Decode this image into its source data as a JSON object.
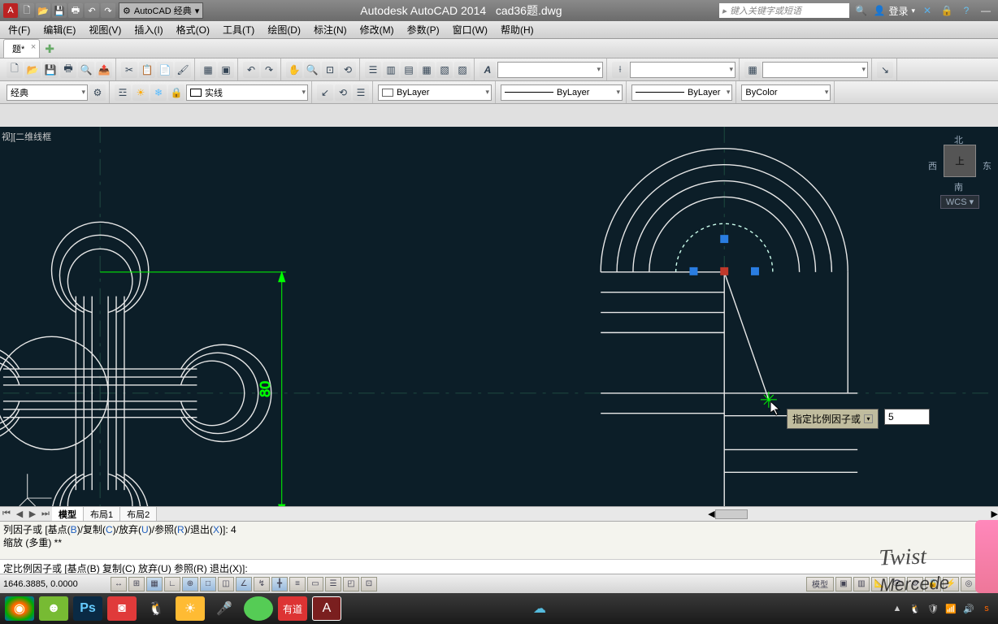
{
  "title": {
    "app": "Autodesk AutoCAD 2014",
    "file": "cad36题.dwg"
  },
  "workspace_dd": "AutoCAD 经典",
  "search_placeholder": "键入关键字或短语",
  "login_label": "登录",
  "menu": [
    "件(F)",
    "编辑(E)",
    "视图(V)",
    "插入(I)",
    "格式(O)",
    "工具(T)",
    "绘图(D)",
    "标注(N)",
    "修改(M)",
    "参数(P)",
    "窗口(W)",
    "帮助(H)"
  ],
  "doc_tab": "题*",
  "toolbar2": {
    "ws_dd": "经典",
    "linetype_dd": "实线",
    "layer_color": "ByLayer",
    "lineweight": "ByLayer",
    "linetype2": "ByLayer",
    "plotstyle": "ByColor"
  },
  "view_label": "视][二维线框",
  "viewcube": {
    "n": "北",
    "s": "南",
    "w": "西",
    "e": "东",
    "top": "上",
    "wcs": "WCS"
  },
  "dimension_value": "80",
  "dyn_prompt": "指定比例因子或",
  "dyn_input_value": "5",
  "layout_tabs": [
    "模型",
    "布局1",
    "布局2"
  ],
  "cmd_history": {
    "line1_pre": "列因子或 [基点(",
    "line1_b": "B",
    "line1_mid1": ")/复制(",
    "line1_c": "C",
    "line1_mid2": ")/放弃(",
    "line1_u": "U",
    "line1_mid3": ")/参照(",
    "line1_r": "R",
    "line1_mid4": ")/退出(",
    "line1_x": "X",
    "line1_post": ")]:  4",
    "line2": "缩放 (多重) **"
  },
  "cmd_prompt": {
    "pre": "定比例因子或 [基点(",
    "b": "B",
    "m1": ") 复制(",
    "c": "C",
    "m2": ") 放弃(",
    "u": "U",
    "m3": ") 参照(",
    "r": "R",
    "m4": ") 退出(",
    "x": "X",
    "post": ")]:"
  },
  "status": {
    "coords": "1646.3885, 0.0000",
    "model_label": "模型"
  }
}
